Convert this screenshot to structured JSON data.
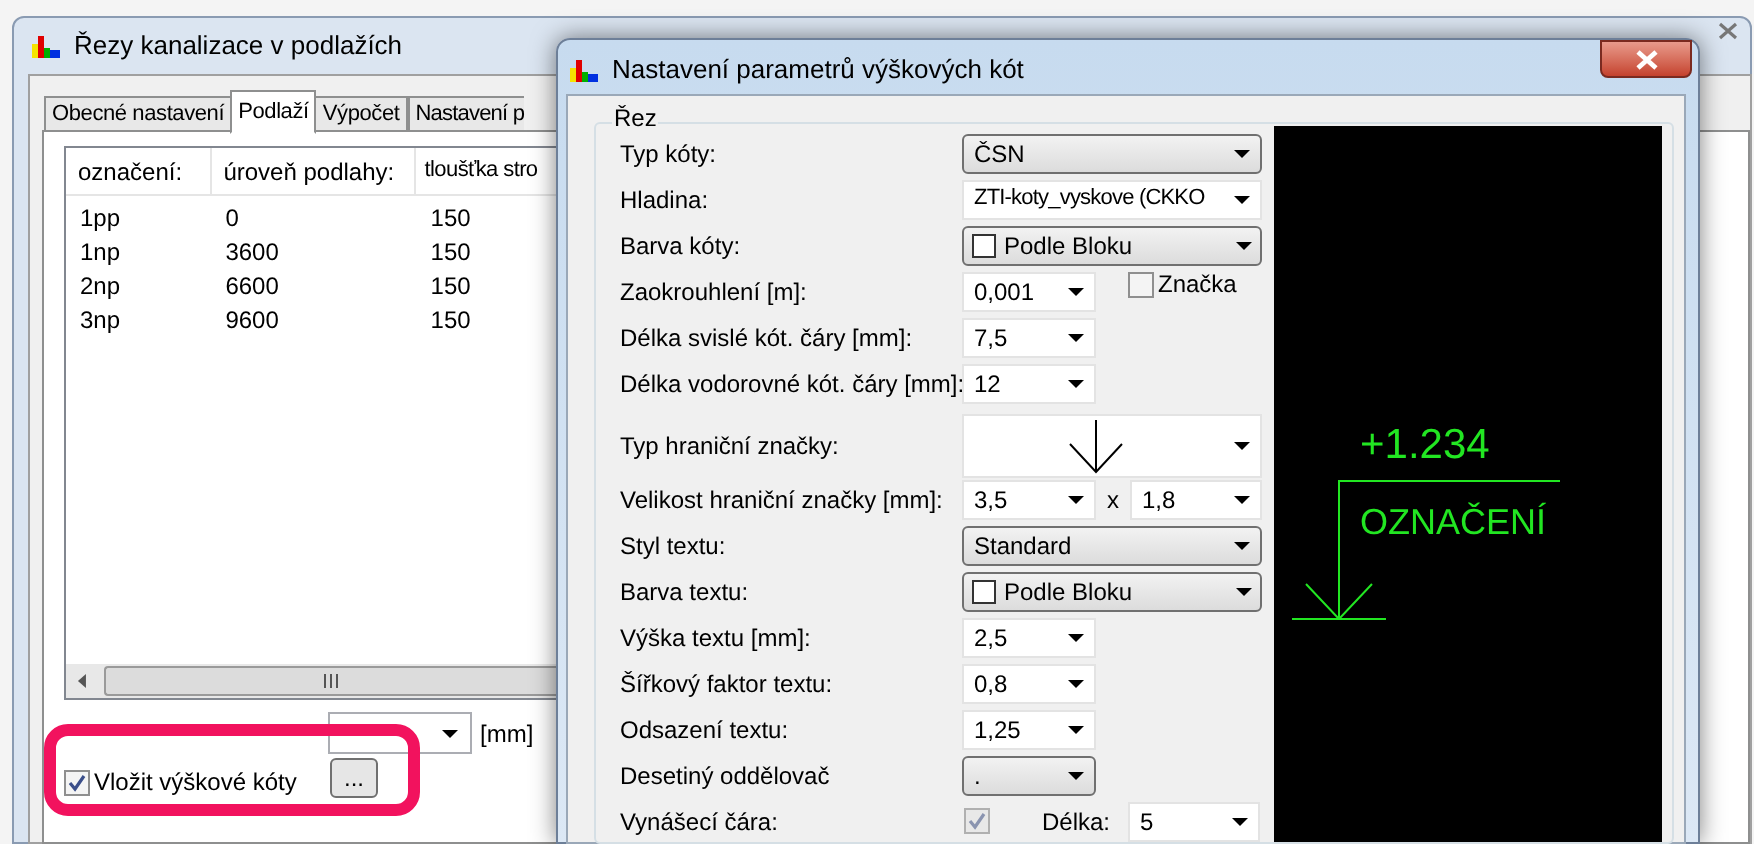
{
  "back_window": {
    "title": "Řezy kanalizace v podlažích",
    "tabs": [
      {
        "label": "Obecné nastavení",
        "selected": false
      },
      {
        "label": "Podlaží",
        "selected": true
      },
      {
        "label": "Výpočet",
        "selected": false
      },
      {
        "label": "Nastavení p",
        "selected": false
      }
    ],
    "table": {
      "columns": [
        "označení:",
        "úroveň podlahy:",
        "tloušťka stro"
      ],
      "rows": [
        [
          "1pp",
          "0",
          "150"
        ],
        [
          "1np",
          "3600",
          "150"
        ],
        [
          "2np",
          "6600",
          "150"
        ],
        [
          "3np",
          "9600",
          "150"
        ]
      ]
    },
    "height_unit": "[mm]",
    "insert_checkbox": {
      "label": "Vložit výškové kóty",
      "checked": true
    },
    "more_button": "...",
    "highlighted": true
  },
  "front_window": {
    "title": "Nastavení parametrů výškových kót",
    "group": "Řez",
    "rows": [
      {
        "label": "Typ kóty:",
        "kind": "dropdown",
        "value": "ČSN"
      },
      {
        "label": "Hladina:",
        "kind": "wide-input",
        "value": "ZTI-koty_vyskove  (CKKO"
      },
      {
        "label": "Barva kóty:",
        "kind": "color-dropdown",
        "value": "Podle Bloku"
      },
      {
        "label": "Zaokrouhlení [m]:",
        "kind": "input",
        "value": "0,001",
        "extra_checkbox": {
          "label": "Značka",
          "checked": false
        }
      },
      {
        "label": "Délka svislé kót. čáry [mm]:",
        "kind": "input",
        "value": "7,5"
      },
      {
        "label": "Délka vodorovné kót. čáry [mm]:",
        "kind": "input",
        "value": "12"
      },
      {
        "label": "Typ hraniční značky:",
        "kind": "marker"
      },
      {
        "label": "Velikost hraniční značky [mm]:",
        "kind": "pair",
        "value": "3,5",
        "separator": "x",
        "value2": "1,8"
      },
      {
        "label": "Styl textu:",
        "kind": "dropdown",
        "value": "Standard"
      },
      {
        "label": "Barva textu:",
        "kind": "color-dropdown",
        "value": "Podle Bloku"
      },
      {
        "label": "Výška textu [mm]:",
        "kind": "input",
        "value": "2,5"
      },
      {
        "label": "Šířkový faktor textu:",
        "kind": "input",
        "value": "0,8"
      },
      {
        "label": "Odsazení textu:",
        "kind": "input",
        "value": "1,25"
      },
      {
        "label": "Desetiný oddělovač",
        "kind": "small-dropdown",
        "value": "."
      },
      {
        "label": "Vynášecí čára:",
        "kind": "checkbox-length",
        "checked": true,
        "length_label": "Délka:",
        "value": "5"
      }
    ],
    "preview": {
      "elevation": "+1.234",
      "label": "OZNAČENÍ"
    }
  }
}
